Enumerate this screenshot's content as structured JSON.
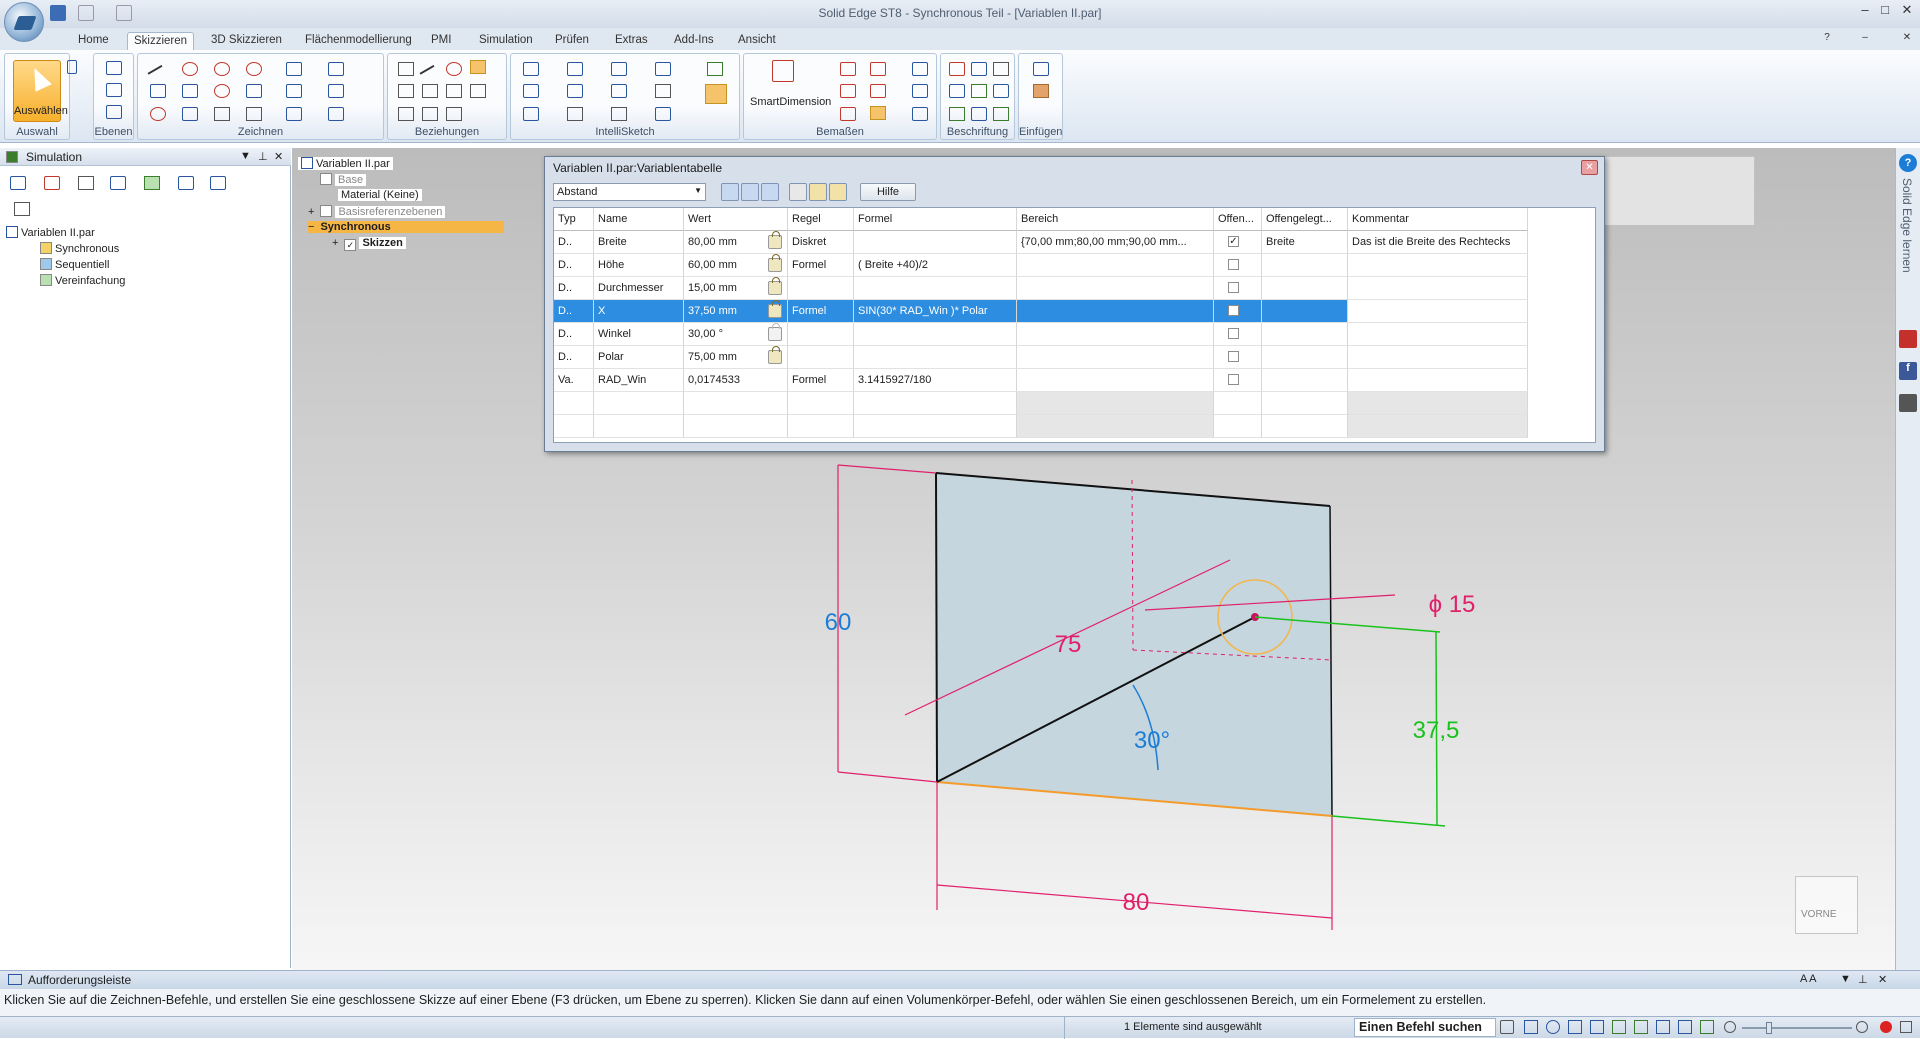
{
  "app": {
    "title": "Solid Edge ST8 - Synchronous Teil - [Variablen II.par]",
    "tabs": [
      "Home",
      "Skizzieren",
      "3D Skizzieren",
      "Flächenmodellierung",
      "PMI",
      "Simulation",
      "Prüfen",
      "Extras",
      "Add-Ins",
      "Ansicht"
    ],
    "active_tab": "Skizzieren"
  },
  "ribbon": {
    "groups": [
      "Auswahl",
      "Ebenen",
      "Zeichnen",
      "Beziehungen",
      "IntelliSketch",
      "Bemaßen",
      "Beschriftung",
      "Einfügen"
    ],
    "select_label": "Auswählen",
    "smartdimension_label": "SmartDimension"
  },
  "left_panel": {
    "title": "Simulation",
    "tree": [
      "Variablen II.par",
      "Synchronous",
      "Sequentiell",
      "Vereinfachung"
    ]
  },
  "model_tree": {
    "items": [
      "Variablen II.par",
      "Base",
      "Material (Keine)",
      "Basisreferenzebenen",
      "Synchronous",
      "Skizzen"
    ]
  },
  "dialog": {
    "title": "Variablen II.par:Variablentabelle",
    "filter": "Abstand",
    "help": "Hilfe",
    "columns": [
      "Typ",
      "Name",
      "Wert",
      "Regel",
      "Formel",
      "Bereich",
      "Offen...",
      "Offengelegt...",
      "Kommentar"
    ],
    "rows": [
      {
        "typ": "D..",
        "name": "Breite",
        "wert": "80,00 mm",
        "regel": "Diskret",
        "formel": "",
        "bereich": "{70,00 mm;80,00 mm;90,00 mm...",
        "offen": true,
        "offengelegt": "Breite",
        "kommentar": "Das ist die Breite des Rechtecks"
      },
      {
        "typ": "D..",
        "name": "Höhe",
        "wert": "60,00 mm",
        "regel": "Formel",
        "formel": "( Breite +40)/2",
        "bereich": "",
        "offen": false,
        "offengelegt": "",
        "kommentar": ""
      },
      {
        "typ": "D..",
        "name": "Durchmesser",
        "wert": "15,00 mm",
        "regel": "",
        "formel": "",
        "bereich": "",
        "offen": false,
        "offengelegt": "",
        "kommentar": ""
      },
      {
        "typ": "D..",
        "name": "X",
        "wert": "37,50 mm",
        "regel": "Formel",
        "formel": "SIN(30* RAD_Win )* Polar",
        "bereich": "",
        "offen": false,
        "offengelegt": "",
        "kommentar": ""
      },
      {
        "typ": "D..",
        "name": "Winkel",
        "wert": "30,00 °",
        "regel": "",
        "formel": "",
        "bereich": "",
        "offen": false,
        "offengelegt": "",
        "kommentar": ""
      },
      {
        "typ": "D..",
        "name": "Polar",
        "wert": "75,00 mm",
        "regel": "",
        "formel": "",
        "bereich": "",
        "offen": false,
        "offengelegt": "",
        "kommentar": ""
      },
      {
        "typ": "Va.",
        "name": "RAD_Win",
        "wert": "0,0174533",
        "regel": "Formel",
        "formel": "3.1415927/180",
        "bereich": "",
        "offen": false,
        "offengelegt": "",
        "kommentar": ""
      }
    ]
  },
  "sketch": {
    "dims": {
      "height": "60",
      "polar": "75",
      "diameter": "ϕ 15",
      "angle": "30°",
      "x": "37,5",
      "width": "80"
    },
    "viewcube": "VORNE"
  },
  "side_label": "Solid Edge lernen",
  "prompt": {
    "title": "Aufforderungsleiste",
    "text": "Klicken Sie auf die Zeichnen-Befehle, und erstellen Sie eine geschlossene Skizze auf einer Ebene (F3 drücken, um Ebene zu sperren). Klicken Sie dann auf einen Volumenkörper-Befehl, oder wählen Sie einen geschlossenen Bereich, um ein Formelement zu erstellen."
  },
  "status": {
    "selection": "1 Elemente sind ausgewählt",
    "search": "Einen Befehl suchen"
  }
}
